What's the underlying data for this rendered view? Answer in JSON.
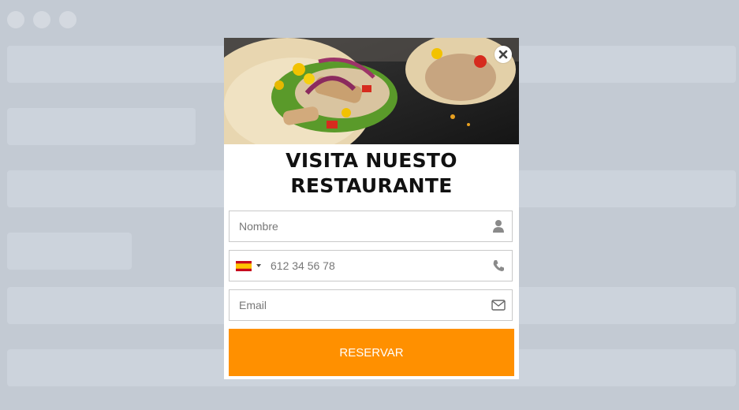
{
  "colors": {
    "background": "#c3cad3",
    "placeholder_block": "#ccd3dc",
    "accent": "#ff9000"
  },
  "popup": {
    "image_alt": "food-wrap-photo",
    "title_line1": "VISITA NUESTO",
    "title_line2": "RESTAURANTE",
    "name_placeholder": "Nombre",
    "phone_placeholder": "612 34 56 78",
    "email_placeholder": "Email",
    "submit_label": "RESERVAR",
    "country_flag": "spain-flag-icon"
  }
}
